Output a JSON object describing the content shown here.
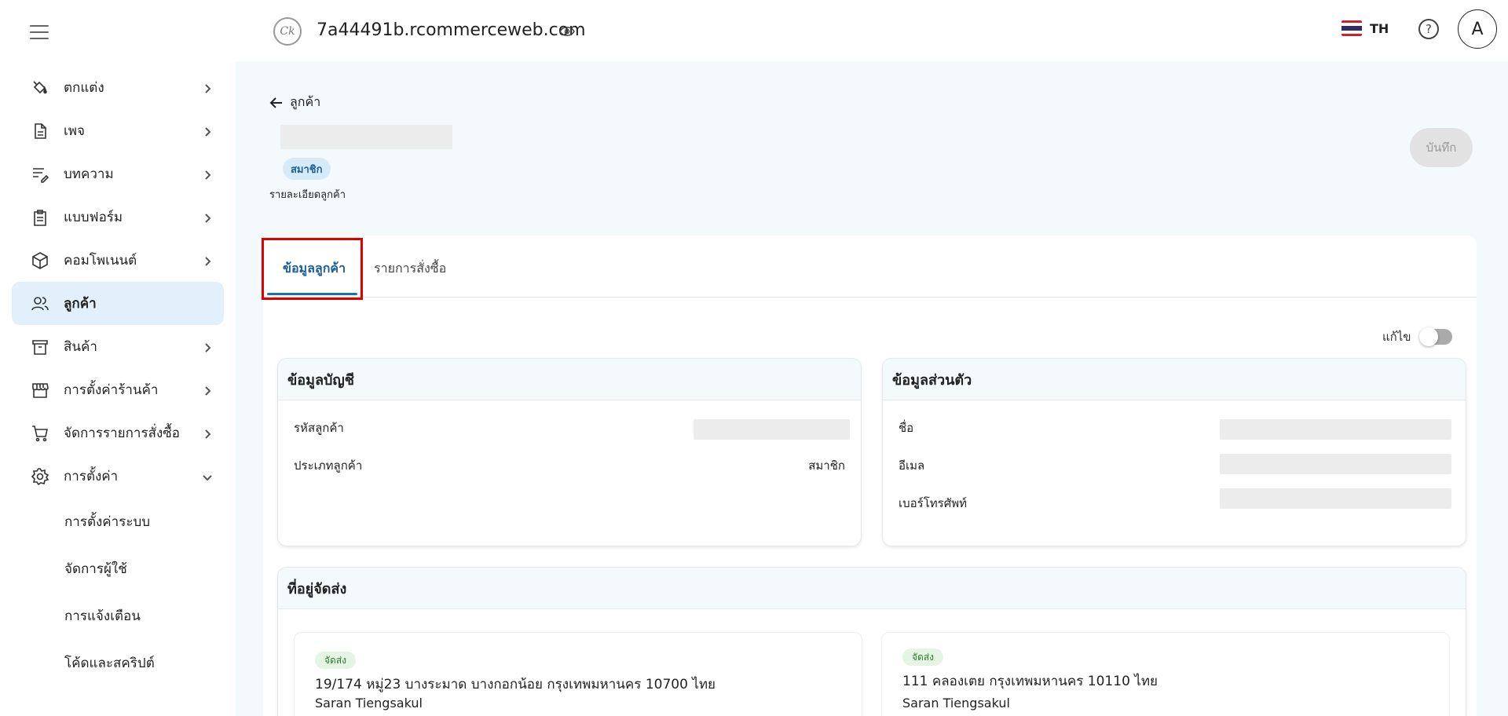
{
  "sidebar": {
    "items": [
      {
        "label": "ตกแต่ง",
        "icon": "paint-bucket-icon",
        "chevron": "right"
      },
      {
        "label": "เพจ",
        "icon": "file-icon",
        "chevron": "right"
      },
      {
        "label": "บทความ",
        "icon": "article-edit-icon",
        "chevron": "right"
      },
      {
        "label": "แบบฟอร์ม",
        "icon": "clipboard-icon",
        "chevron": "right"
      },
      {
        "label": "คอมโพเนนต์",
        "icon": "cube-icon",
        "chevron": "right"
      },
      {
        "label": "ลูกค้า",
        "icon": "users-icon",
        "active": true
      },
      {
        "label": "สินค้า",
        "icon": "archive-box-icon",
        "chevron": "right"
      },
      {
        "label": "การตั้งค่าร้านค้า",
        "icon": "store-icon",
        "chevron": "right"
      },
      {
        "label": "จัดการรายการสั่งซื้อ",
        "icon": "cart-icon",
        "chevron": "right"
      },
      {
        "label": "การตั้งค่า",
        "icon": "gear-icon",
        "chevron": "down"
      }
    ],
    "sub_items": [
      "การตั้งค่าระบบ",
      "จัดการผู้ใช้",
      "การแจ้งเตือน",
      "โค้ดและสคริปต์"
    ]
  },
  "header": {
    "site_url": "7a44491b.rcommerceweb.com",
    "lang": "TH",
    "help": "?",
    "avatar_initial": "A"
  },
  "page": {
    "back_label": "ลูกค้า",
    "member_badge": "สมาชิก",
    "customer_detail": "รายละเอียดลูกค้า",
    "save_label": "บันทึก"
  },
  "tabs": {
    "active": "ข้อมูลลูกค้า",
    "inactive": "รายการสั่งซื้อ"
  },
  "edit_label": "แก้ไข",
  "account": {
    "title": "ข้อมูลบัญชี",
    "customer_id_label": "รหัสลูกค้า",
    "customer_type_label": "ประเภทลูกค้า",
    "customer_type_value": "สมาชิก"
  },
  "personal": {
    "title": "ข้อมูลส่วนตัว",
    "name_label": "ชื่อ",
    "email_label": "อีเมล",
    "phone_label": "เบอร์โทรศัพท์"
  },
  "shipping": {
    "title": "ที่อยู่จัดส่ง",
    "addresses": [
      {
        "badge": "จัดส่ง",
        "line": "19/174 หมู่23 บางระมาด บางกอกน้อย กรุงเทพมหานคร 10700 ไทย",
        "name": "Saran Tiengsakul"
      },
      {
        "badge": "จัดส่ง",
        "line": "111 คลองเตย กรุงเทพมหานคร 10110 ไทย",
        "name": "Saran Tiengsakul"
      }
    ]
  },
  "colors": {
    "accent": "#1c5f96",
    "highlight": "#e00000",
    "active_bg": "#e1f0fb"
  }
}
